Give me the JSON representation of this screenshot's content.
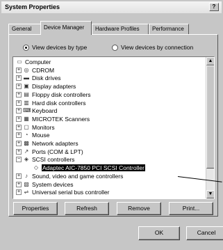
{
  "window": {
    "title": "System Properties",
    "help_button": "?"
  },
  "tabs": [
    "General",
    "Device Manager",
    "Hardware Profiles",
    "Performance"
  ],
  "view_options": {
    "by_type": "View devices by type",
    "by_connection": "View devices by connection",
    "selected": "by_type"
  },
  "tree": {
    "items": [
      {
        "label": "Computer",
        "icon": "computer-icon",
        "expander": ""
      },
      {
        "label": "CDROM",
        "icon": "cdrom-icon",
        "expander": "+"
      },
      {
        "label": "Disk drives",
        "icon": "disk-drive-icon",
        "expander": "+"
      },
      {
        "label": "Display adapters",
        "icon": "display-adapter-icon",
        "expander": "+"
      },
      {
        "label": "Floppy disk controllers",
        "icon": "floppy-controller-icon",
        "expander": "+"
      },
      {
        "label": "Hard disk controllers",
        "icon": "hard-disk-controller-icon",
        "expander": "+"
      },
      {
        "label": "Keyboard",
        "icon": "keyboard-icon",
        "expander": "+"
      },
      {
        "label": "MICROTEK Scanners",
        "icon": "scanner-icon",
        "expander": "+"
      },
      {
        "label": "Monitors",
        "icon": "monitor-icon",
        "expander": "+"
      },
      {
        "label": "Mouse",
        "icon": "mouse-icon",
        "expander": "+"
      },
      {
        "label": "Network adapters",
        "icon": "network-adapter-icon",
        "expander": "+"
      },
      {
        "label": "Ports (COM & LPT)",
        "icon": "port-icon",
        "expander": "+"
      },
      {
        "label": "SCSI controllers",
        "icon": "scsi-controller-icon",
        "expander": "−"
      },
      {
        "label": "Adaptec AIC-7850 PCI SCSI Controller",
        "icon": "scsi-device-icon",
        "expander": "",
        "selected": true
      },
      {
        "label": "Sound, video and game controllers",
        "icon": "sound-icon",
        "expander": "+"
      },
      {
        "label": "System devices",
        "icon": "system-devices-icon",
        "expander": "+"
      },
      {
        "label": "Universal serial bus controller",
        "icon": "usb-icon",
        "expander": "+"
      }
    ]
  },
  "buttons": {
    "properties": "Properties",
    "refresh": "Refresh",
    "remove": "Remove",
    "print": "Print...",
    "ok": "OK",
    "cancel": "Cancel"
  },
  "scrollbar": {
    "up": "▲",
    "down": "▼"
  }
}
